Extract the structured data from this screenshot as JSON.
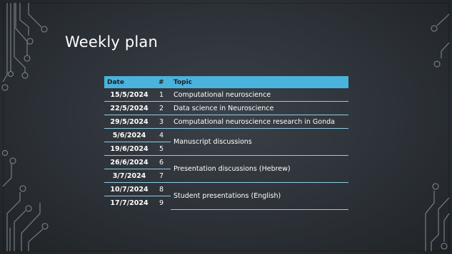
{
  "slide": {
    "title": "Weekly plan",
    "accent_color": "#4ab3dc",
    "background_color": "#2c3137",
    "table": {
      "headers": {
        "date": "Date",
        "num": "#",
        "topic": "Topic"
      },
      "rows": [
        {
          "date": "15/5/2024",
          "num": "1",
          "topic": "Computational neuroscience"
        },
        {
          "date": "22/5/2024",
          "num": "2",
          "topic": "Data science in Neuroscience"
        },
        {
          "date": "29/5/2024",
          "num": "3",
          "topic": "Computational neuroscience research in Gonda"
        },
        {
          "date": "5/6/2024",
          "num": "4",
          "topic": "Manuscript discussions"
        },
        {
          "date": "19/6/2024",
          "num": "5",
          "topic": ""
        },
        {
          "date": "26/6/2024",
          "num": "6",
          "topic": "Presentation discussions (Hebrew)"
        },
        {
          "date": "3/7/2024",
          "num": "7",
          "topic": ""
        },
        {
          "date": "10/7/2024",
          "num": "8",
          "topic": "Student presentations (English)"
        },
        {
          "date": "17/7/2024",
          "num": "9",
          "topic": ""
        }
      ]
    }
  }
}
